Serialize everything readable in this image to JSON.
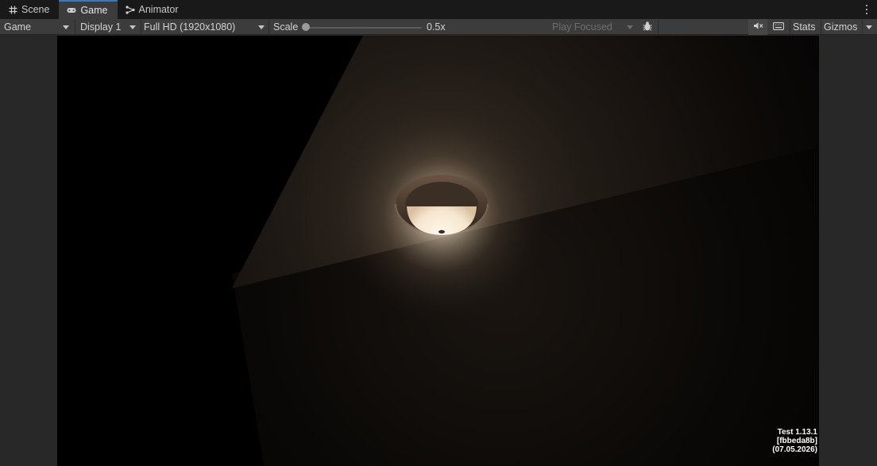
{
  "tabs": [
    {
      "label": "Scene",
      "icon": "grid-icon",
      "active": false
    },
    {
      "label": "Game",
      "icon": "gamepad-icon",
      "active": true
    },
    {
      "label": "Animator",
      "icon": "animator-icon",
      "active": false
    }
  ],
  "toolbar": {
    "view_mode": "Game",
    "display": "Display 1",
    "resolution": "Full HD (1920x1080)",
    "scale_label": "Scale",
    "scale_value": "0.5x",
    "play_mode": "Play Focused",
    "stats_label": "Stats",
    "gizmos_label": "Gizmos"
  },
  "game_overlay": {
    "version_line1": "Test 1.13.1",
    "version_line2": "[fbbeda8b]",
    "version_line3": "(07.05.2026)"
  },
  "colors": {
    "tab_active_accent": "#3a79bb",
    "panel": "#3c3c3c",
    "tabstrip": "#191919",
    "lamp_glow": "#f4e4cc"
  }
}
